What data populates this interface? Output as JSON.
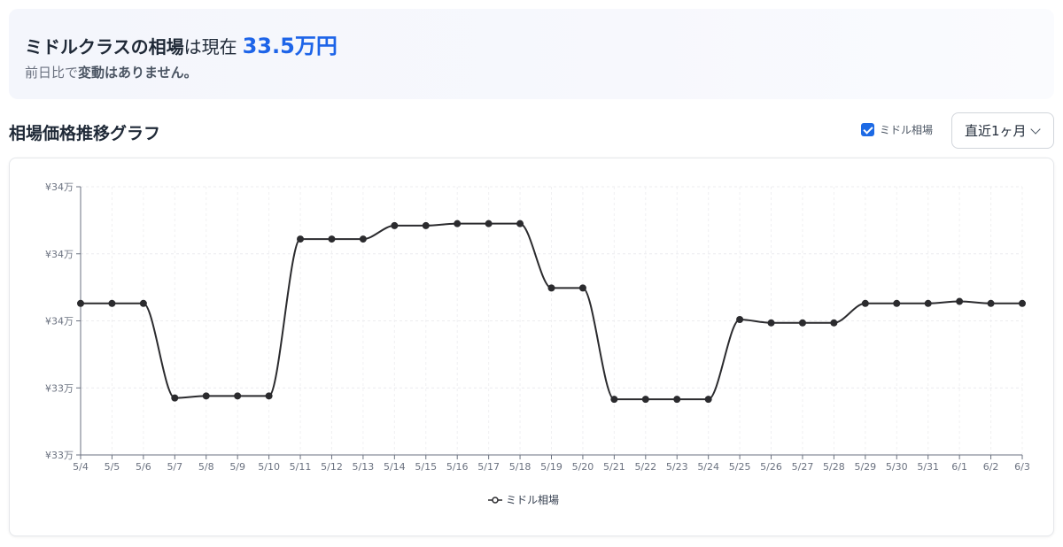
{
  "summary": {
    "label": "ミドルクラスの相場",
    "mid": "は現在",
    "price": "33.5万円",
    "change_prefix": "前日比で",
    "change_strong": "変動はありません。"
  },
  "section_title": "相場価格推移グラフ",
  "legend_toggle": {
    "label": "ミドル相場",
    "checked": true
  },
  "period_select": {
    "value": "直近1ヶ月"
  },
  "chart_data": {
    "type": "line",
    "title": "",
    "xlabel": "",
    "ylabel": "",
    "categories": [
      "5/4",
      "5/5",
      "5/6",
      "5/7",
      "5/8",
      "5/9",
      "5/10",
      "5/11",
      "5/12",
      "5/13",
      "5/14",
      "5/15",
      "5/16",
      "5/17",
      "5/18",
      "5/19",
      "5/20",
      "5/21",
      "5/22",
      "5/23",
      "5/24",
      "5/25",
      "5/26",
      "5/27",
      "5/28",
      "5/29",
      "5/30",
      "5/31",
      "6/1",
      "6/2",
      "6/3"
    ],
    "y_tick_labels": [
      "¥34万",
      "¥34万",
      "¥34万",
      "¥33万",
      "¥33万"
    ],
    "ylim": [
      332000,
      352000
    ],
    "grid": true,
    "legend_position": "bottom",
    "series": [
      {
        "name": "ミドル相場",
        "color": "#2b2b2e",
        "values": [
          343300,
          343300,
          343300,
          336250,
          336400,
          336400,
          336400,
          348100,
          348100,
          348100,
          349100,
          349100,
          349250,
          349250,
          349250,
          344450,
          344450,
          336150,
          336150,
          336150,
          336150,
          342100,
          341850,
          341850,
          341850,
          343300,
          343300,
          343300,
          343450,
          343300,
          343300
        ]
      }
    ]
  }
}
